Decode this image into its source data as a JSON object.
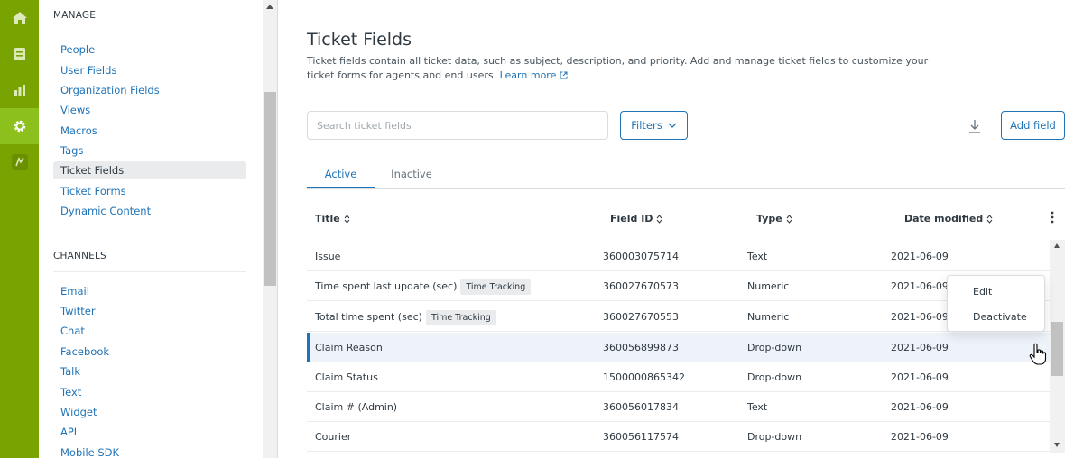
{
  "rail": {
    "items": [
      {
        "icon": "home-icon"
      },
      {
        "icon": "views-icon"
      },
      {
        "icon": "reporting-icon"
      },
      {
        "icon": "admin-gear-icon",
        "active": true
      },
      {
        "icon": "apps-icon"
      }
    ],
    "colors": {
      "rail_bg": "#78a300",
      "active_bg": "#8cc01d"
    }
  },
  "sidebar": {
    "manage_heading": "MANAGE",
    "manage_items": [
      {
        "label": "People"
      },
      {
        "label": "User Fields"
      },
      {
        "label": "Organization Fields"
      },
      {
        "label": "Views"
      },
      {
        "label": "Macros"
      },
      {
        "label": "Tags"
      },
      {
        "label": "Ticket Fields",
        "selected": true
      },
      {
        "label": "Ticket Forms"
      },
      {
        "label": "Dynamic Content"
      }
    ],
    "channels_heading": "CHANNELS",
    "channel_items": [
      {
        "label": "Email"
      },
      {
        "label": "Twitter"
      },
      {
        "label": "Chat"
      },
      {
        "label": "Facebook"
      },
      {
        "label": "Talk"
      },
      {
        "label": "Text"
      },
      {
        "label": "Widget"
      },
      {
        "label": "API"
      },
      {
        "label": "Mobile SDK"
      }
    ]
  },
  "page": {
    "title": "Ticket Fields",
    "description": "Ticket fields contain all ticket data, such as subject, description, and priority. Add and manage ticket fields to customize your ticket forms for agents and end users.",
    "learn_more": "Learn more"
  },
  "toolbar": {
    "search_placeholder": "Search ticket fields",
    "filters_label": "Filters",
    "add_field_label": "Add field"
  },
  "tabs": [
    {
      "label": "Active",
      "active": true
    },
    {
      "label": "Inactive"
    }
  ],
  "table": {
    "columns": [
      {
        "label": "Title"
      },
      {
        "label": "Field ID"
      },
      {
        "label": "Type"
      },
      {
        "label": "Date modified"
      }
    ],
    "rows": [
      {
        "title": "Issue",
        "tag": "",
        "field_id": "360003075714",
        "type": "Text",
        "date": "2021-06-09"
      },
      {
        "title": "Time spent last update (sec)",
        "tag": "Time Tracking",
        "field_id": "360027670573",
        "type": "Numeric",
        "date": "2021-06-09"
      },
      {
        "title": "Total time spent (sec)",
        "tag": "Time Tracking",
        "field_id": "360027670553",
        "type": "Numeric",
        "date": "2021-06-09"
      },
      {
        "title": "Claim Reason",
        "tag": "",
        "field_id": "360056899873",
        "type": "Drop-down",
        "date": "2021-06-09",
        "highlighted": true
      },
      {
        "title": "Claim Status",
        "tag": "",
        "field_id": "1500000865342",
        "type": "Drop-down",
        "date": "2021-06-09"
      },
      {
        "title": "Claim # (Admin)",
        "tag": "",
        "field_id": "360056017834",
        "type": "Text",
        "date": "2021-06-09"
      },
      {
        "title": "Courier",
        "tag": "",
        "field_id": "360056117574",
        "type": "Drop-down",
        "date": "2021-06-09"
      }
    ]
  },
  "row_menu": {
    "edit_label": "Edit",
    "deactivate_label": "Deactivate"
  },
  "colors": {
    "link_blue": "#1f73b7",
    "text": "#2f3941",
    "highlight_row": "#edf3f9"
  }
}
